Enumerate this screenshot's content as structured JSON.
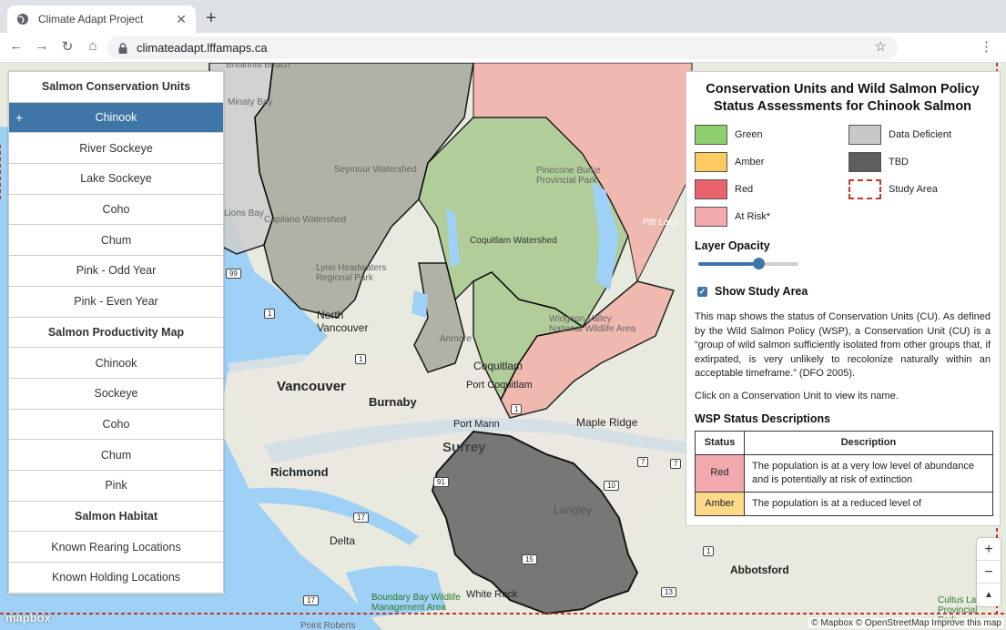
{
  "browser": {
    "tab_title": "Climate Adapt Project",
    "tab_close": "✕",
    "new_tab": "+",
    "url": "climateadapt.lffamaps.ca"
  },
  "map": {
    "places": [
      {
        "id": "britannia",
        "text": "Britannia Beach"
      },
      {
        "id": "minaty",
        "text": "Minaty Bay"
      },
      {
        "id": "lions",
        "text": "Lions Bay"
      },
      {
        "id": "seymour",
        "text": "Seymour Watershed"
      },
      {
        "id": "capilano",
        "text": "Capilano Watershed"
      },
      {
        "id": "lynn",
        "text": "Lynn Headwaters Regional Park"
      },
      {
        "id": "pinecone",
        "text": "Pinecone Burke Provincial Park"
      },
      {
        "id": "coquitlamws",
        "text": "Coquitlam Watershed"
      },
      {
        "id": "pitt",
        "text": "Pitt Lake"
      },
      {
        "id": "widgeon",
        "text": "Widgeon Valley National Wildlife Area"
      },
      {
        "id": "northvan",
        "text": "North Vancouver"
      },
      {
        "id": "anmore",
        "text": "Anmore"
      },
      {
        "id": "coquitlam",
        "text": "Coquitlam"
      },
      {
        "id": "portcoq",
        "text": "Port Coquitlam"
      },
      {
        "id": "vancouver",
        "text": "Vancouver"
      },
      {
        "id": "burnaby",
        "text": "Burnaby"
      },
      {
        "id": "portmann",
        "text": "Port Mann"
      },
      {
        "id": "mapleridge",
        "text": "Maple Ridge"
      },
      {
        "id": "surrey",
        "text": "Surrey"
      },
      {
        "id": "richmond",
        "text": "Richmond"
      },
      {
        "id": "langley",
        "text": "Langley"
      },
      {
        "id": "delta",
        "text": "Delta"
      },
      {
        "id": "abbotsford",
        "text": "Abbotsford"
      },
      {
        "id": "boundary",
        "text": "Boundary Bay Wildlife Management Area"
      },
      {
        "id": "whiterock",
        "text": "White Rock"
      },
      {
        "id": "pointroberts",
        "text": "Point Roberts"
      },
      {
        "id": "cultus",
        "text": "Cultus Lake Provincial Park"
      }
    ],
    "highways": [
      "99",
      "1",
      "1",
      "1",
      "7",
      "7",
      "17",
      "17",
      "15",
      "10",
      "1",
      "13",
      "17",
      "91"
    ],
    "controls": {
      "zoom_in": "+",
      "zoom_out": "−",
      "compass": "▲"
    },
    "logo": "mapbox",
    "attribution": "© Mapbox © OpenStreetMap  Improve this map"
  },
  "left_panel": {
    "sections": [
      {
        "heading": "Salmon Conservation Units",
        "items": [
          "Chinook",
          "River Sockeye",
          "Lake Sockeye",
          "Coho",
          "Chum",
          "Pink - Odd Year",
          "Pink - Even Year"
        ]
      },
      {
        "heading": "Salmon Productivity Map",
        "items": [
          "Chinook",
          "Sockeye",
          "Coho",
          "Chum",
          "Pink"
        ]
      },
      {
        "heading": "Salmon Habitat",
        "items": [
          "Known Rearing Locations",
          "Known Holding Locations"
        ]
      }
    ],
    "active_marker": "+"
  },
  "right_panel": {
    "title": "Conservation Units and Wild Salmon Policy Status Assessments for Chinook Salmon",
    "legend": [
      {
        "label": "Green",
        "color": "#8fce6e"
      },
      {
        "label": "Data Deficient",
        "color": "#c8c8c8"
      },
      {
        "label": "Amber",
        "color": "#ffcb60"
      },
      {
        "label": "TBD",
        "color": "#5e5e5e"
      },
      {
        "label": "Red",
        "color": "#e8636b"
      },
      {
        "label": "Study Area",
        "color": "dashed"
      },
      {
        "label": "At Risk*",
        "color": "#f2a9ae"
      }
    ],
    "opacity_heading": "Layer Opacity",
    "opacity_value": 0.6,
    "show_study_area": "Show Study Area",
    "description": "This map shows the status of Conservation Units (CU). As defined by the Wild Salmon Policy (WSP), a Conservation Unit (CU) is a “group of wild salmon sufficiently isolated from other groups that, if extirpated, is very unlikely to recolonize naturally within an acceptable timeframe.” (DFO 2005).",
    "click_hint": "Click on a Conservation Unit to view its name.",
    "wsp_heading": "WSP Status Descriptions",
    "table": {
      "headers": [
        "Status",
        "Description"
      ],
      "rows": [
        {
          "status": "Red",
          "desc": "The population is at a very low level of abundance and is potentially at risk of extinction",
          "color": "#f2a9ae"
        },
        {
          "status": "Amber",
          "desc": "The population is at a reduced level of",
          "color": "#ffd98a"
        }
      ]
    }
  }
}
